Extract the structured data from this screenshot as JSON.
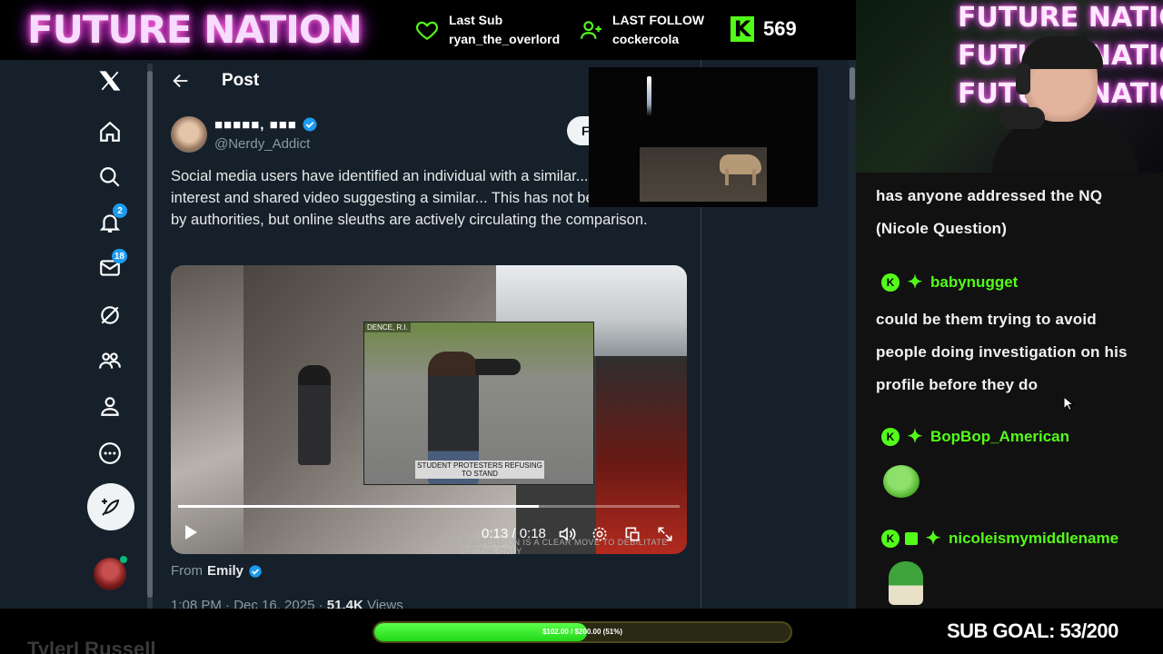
{
  "overlay": {
    "brand": "FUTURE NATION",
    "last_sub_label": "Last Sub",
    "last_sub_name": "ryan_the_overlord",
    "last_follow_label": "LAST FOLLOW",
    "last_follow_name": "cockercola",
    "kick_count": "569",
    "channel_name": "TylerI Russell",
    "goal_text": "$102.00 / $200.00 (51%)",
    "goal_progress": 0.51,
    "sub_goal": "SUB GOAL: 53/200"
  },
  "x": {
    "nav": [
      {
        "icon": "x-logo-icon"
      },
      {
        "icon": "home-icon"
      },
      {
        "icon": "search-icon"
      },
      {
        "icon": "notifications-icon",
        "badge": "2"
      },
      {
        "icon": "messages-icon",
        "badge": "18"
      },
      {
        "icon": "grok-icon"
      },
      {
        "icon": "communities-icon"
      },
      {
        "icon": "profile-icon"
      },
      {
        "icon": "more-icon"
      }
    ],
    "header_title": "Post",
    "author_name": "■■■■■, ■■■",
    "author_handle": "@Nerdy_Addict",
    "follow_label": "F",
    "tweet_text": "Social media users have identified an individual with a similar... the person of interest and shared video suggesting a similar... This has not been validated by authorities, but online sleuths are actively circulating the comparison.",
    "video": {
      "inset_caption_top": "DENCE, R.I.",
      "inset_caption": "STUDENT PROTESTERS REFUSING TO STAND",
      "subtitle": "THE SUSPENSION IS A CLEAR MOVE TO DEBILITATE ONE OF THE ONLY",
      "time": "0:13 / 0:18",
      "progress": 0.72
    },
    "from_label": "From",
    "from_name": "Emily",
    "meta_time": "1:08 PM · Dec 16, 2025 · ",
    "meta_views": "51.4K",
    "meta_views_label": " Views"
  },
  "chat": [
    {
      "type": "text",
      "text": "has anyone addressed the NQ (Nicole Question)"
    },
    {
      "type": "user",
      "name": "babynugget"
    },
    {
      "type": "text",
      "text": "could be them trying to avoid people doing investigation on his profile before they do"
    },
    {
      "type": "user",
      "name": "BopBop_American"
    },
    {
      "type": "emote",
      "name": "frog-emote"
    },
    {
      "type": "user",
      "name": "nicoleismymiddlename"
    },
    {
      "type": "emote",
      "name": "pepe-emote"
    }
  ],
  "colors": {
    "kick_green": "#53fc18",
    "x_blue": "#1d9bf0",
    "x_bg": "#15202b"
  }
}
